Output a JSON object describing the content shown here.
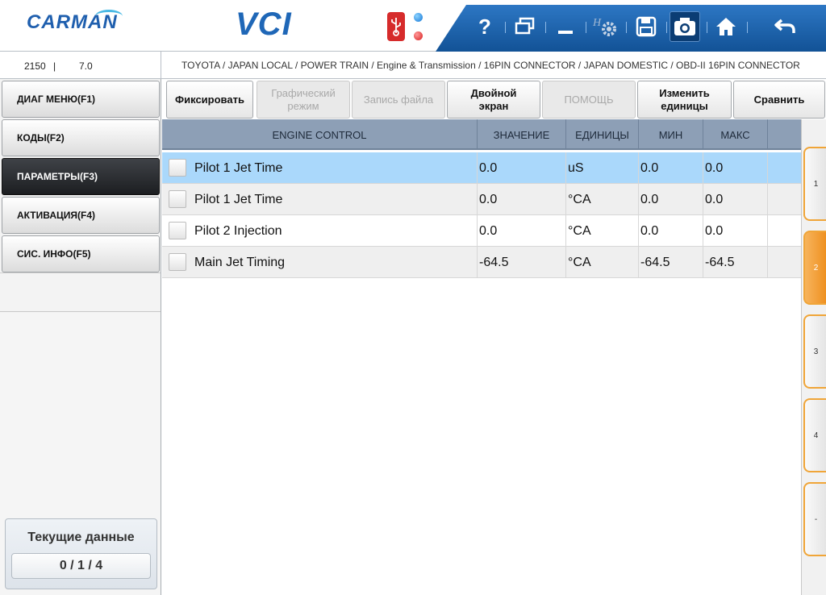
{
  "header": {
    "logo_text": "CARMAN",
    "app_title": "VCI",
    "toolbar": {
      "help_glyph": "?",
      "icons": [
        "usb-icon",
        "status-led-blue",
        "status-led-red",
        "help-icon",
        "window-icon",
        "minimize-icon",
        "settings-icon",
        "save-icon",
        "camera-icon",
        "home-icon",
        "back-icon"
      ]
    }
  },
  "infobar": {
    "code": "2150",
    "separator": "|",
    "version": "7.0",
    "breadcrumb": "TOYOTA / JAPAN LOCAL / POWER TRAIN / Engine & Transmission / 16PIN CONNECTOR / JAPAN DOMESTIC / OBD-II 16PIN CONNECTOR"
  },
  "sidebar": {
    "items": [
      {
        "label": "ДИАГ МЕНЮ(F1)"
      },
      {
        "label": "КОДЫ(F2)"
      },
      {
        "label": "ПАРАМЕТРЫ(F3)"
      },
      {
        "label": "АКТИВАЦИЯ(F4)"
      },
      {
        "label": "СИС. ИНФО(F5)"
      }
    ],
    "active_index": 2,
    "data_panel": {
      "title": "Текущие данные",
      "count": "0 / 1 / 4"
    }
  },
  "function_buttons": {
    "fix": "Фиксировать",
    "graph_line1": "Графический",
    "graph_line2": "режим",
    "record": "Запись файла",
    "dual_line1": "Двойной",
    "dual_line2": "экран",
    "help": "ПОМОЩЬ",
    "units_line1": "Изменить",
    "units_line2": "единицы",
    "compare": "Сравнить"
  },
  "table": {
    "columns": [
      "ENGINE CONTROL",
      "ЗНАЧЕНИЕ",
      "ЕДИНИЦЫ",
      "МИН",
      "МАКС"
    ],
    "rows": [
      {
        "name": "Pilot 1 Jet Time",
        "value": "0.0",
        "unit": "uS",
        "min": "0.0",
        "max": "0.0"
      },
      {
        "name": "Pilot 1 Jet Time",
        "value": "0.0",
        "unit": "°CA",
        "min": "0.0",
        "max": "0.0"
      },
      {
        "name": "Pilot 2 Injection",
        "value": "0.0",
        "unit": "°CA",
        "min": "0.0",
        "max": "0.0"
      },
      {
        "name": "Main Jet Timing",
        "value": "-64.5",
        "unit": "°CA",
        "min": "-64.5",
        "max": "-64.5"
      }
    ],
    "selected_index": 0
  },
  "pages": {
    "tabs": [
      "1",
      "2",
      "3",
      "4",
      "-"
    ],
    "active_index": 1
  },
  "colors": {
    "toolbar_blue": "#1f67b7",
    "header_row": "#8d9fb6",
    "selected_row": "#aad8fb",
    "active_tab": "#ee8f1f"
  }
}
